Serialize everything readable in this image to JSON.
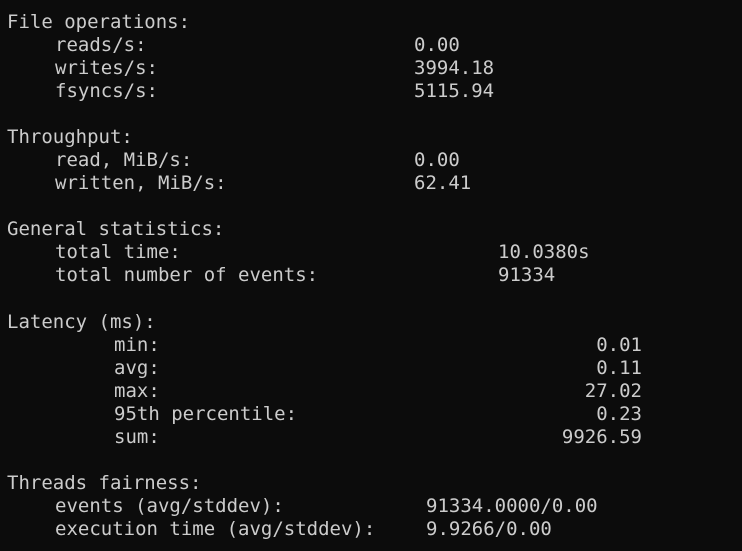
{
  "colors": {
    "background": "#0c0c0c",
    "foreground": "#cccccc"
  },
  "file_operations": {
    "header": "File operations:",
    "rows": [
      {
        "label": "reads/s:",
        "value": "0.00"
      },
      {
        "label": "writes/s:",
        "value": "3994.18"
      },
      {
        "label": "fsyncs/s:",
        "value": "5115.94"
      }
    ]
  },
  "throughput": {
    "header": "Throughput:",
    "rows": [
      {
        "label": "read, MiB/s:",
        "value": "0.00"
      },
      {
        "label": "written, MiB/s:",
        "value": "62.41"
      }
    ]
  },
  "general_statistics": {
    "header": "General statistics:",
    "rows": [
      {
        "label": "total time:",
        "value": "10.0380s"
      },
      {
        "label": "total number of events:",
        "value": "91334"
      }
    ]
  },
  "latency": {
    "header": "Latency (ms):",
    "rows": [
      {
        "label": "min:",
        "value": "0.01"
      },
      {
        "label": "avg:",
        "value": "0.11"
      },
      {
        "label": "max:",
        "value": "27.02"
      },
      {
        "label": "95th percentile:",
        "value": "0.23"
      },
      {
        "label": "sum:",
        "value": "9926.59"
      }
    ]
  },
  "threads_fairness": {
    "header": "Threads fairness:",
    "rows": [
      {
        "label": "events (avg/stddev):",
        "value": "91334.0000/0.00"
      },
      {
        "label": "execution time (avg/stddev):",
        "value": "9.9266/0.00"
      }
    ]
  }
}
